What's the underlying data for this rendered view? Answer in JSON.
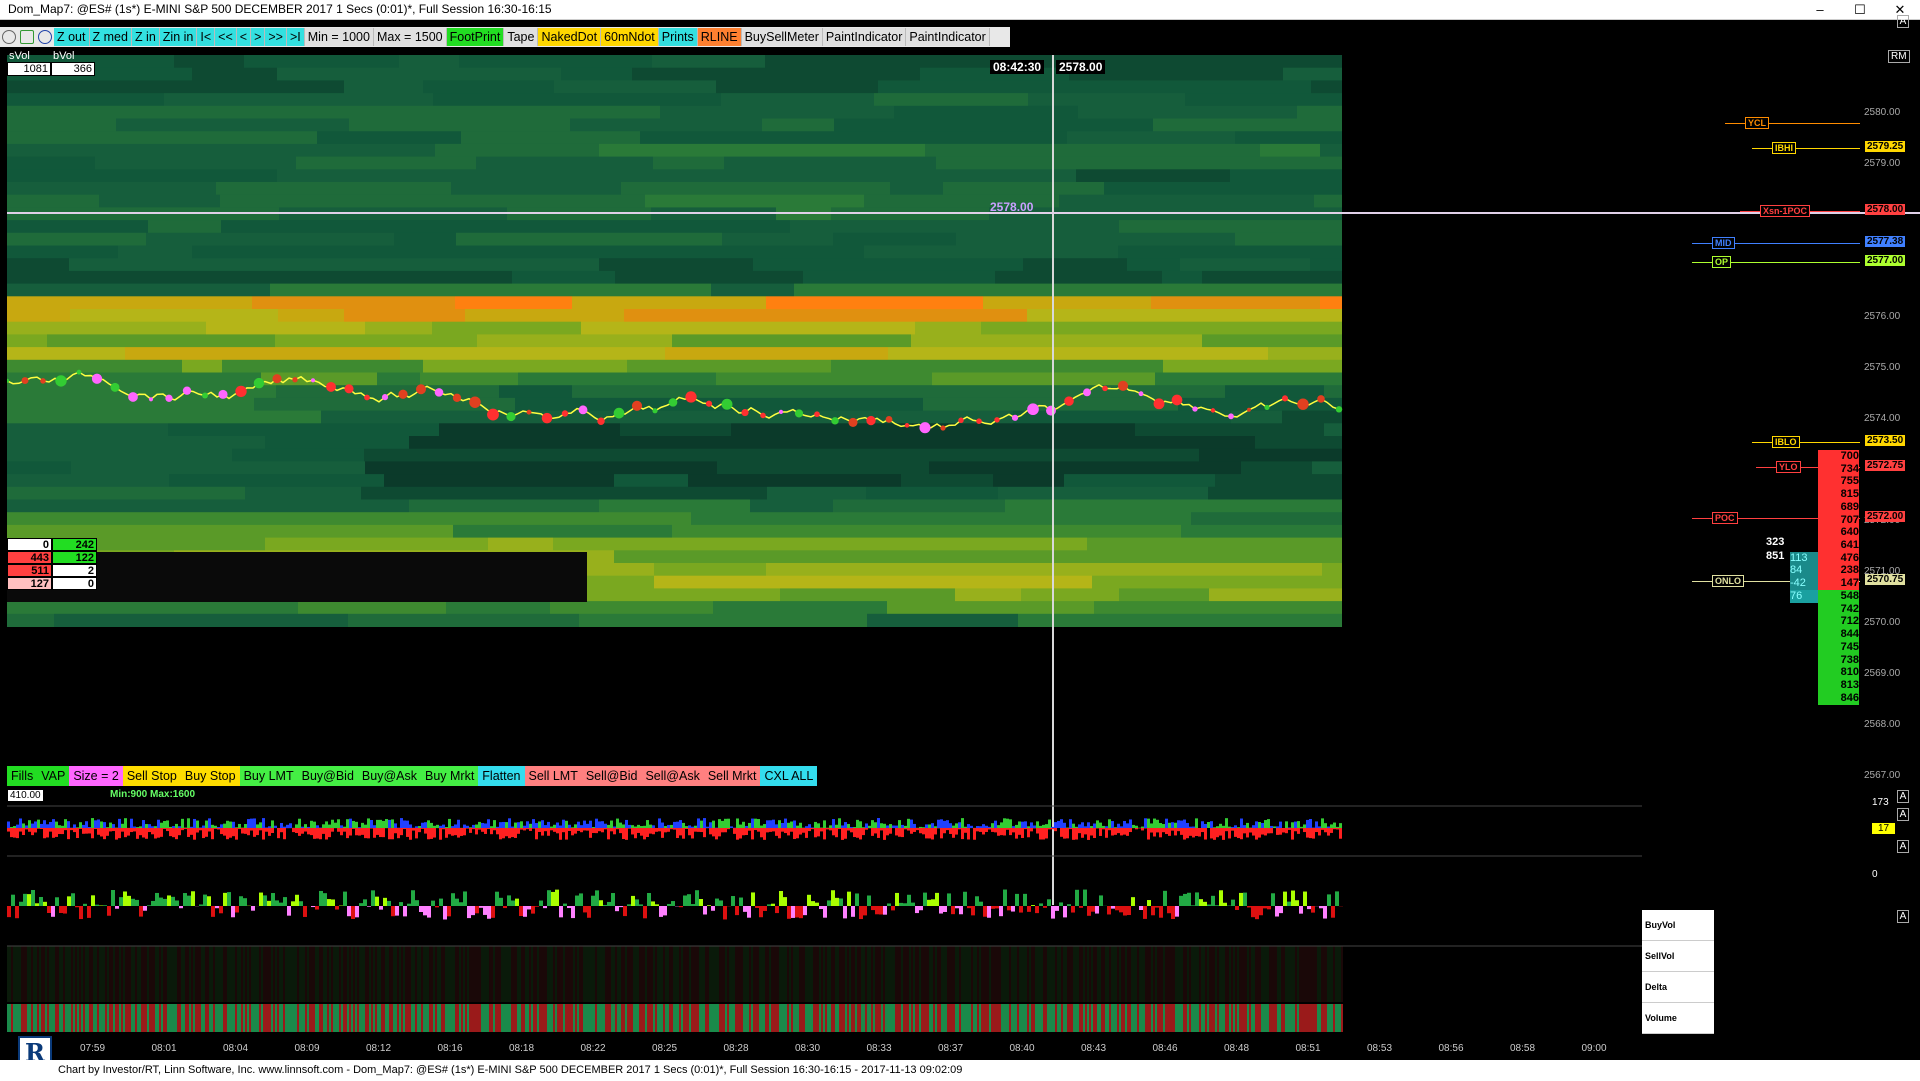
{
  "window": {
    "title": "Dom_Map7: @ES# (1s*) E-MINI S&P 500 DECEMBER 2017 1 Secs (0:01)*, Full Session 16:30-16:15",
    "minimize": "–",
    "maximize": "☐",
    "close": "✕"
  },
  "toolbar": {
    "items": [
      {
        "label": "Z out",
        "style": "cyan"
      },
      {
        "label": "Z med",
        "style": "cyan"
      },
      {
        "label": "Z in",
        "style": "cyan"
      },
      {
        "label": "Zin in",
        "style": "cyan"
      },
      {
        "label": "I<",
        "style": "cyan"
      },
      {
        "label": "<<",
        "style": "cyan"
      },
      {
        "label": "<",
        "style": "cyan"
      },
      {
        "label": ">",
        "style": "cyan"
      },
      {
        "label": ">>",
        "style": "cyan"
      },
      {
        "label": ">I",
        "style": "cyan"
      },
      {
        "label": "Min = 1000",
        "style": "gray"
      },
      {
        "label": "Max = 1500",
        "style": "gray"
      },
      {
        "label": "FootPrint",
        "style": "green"
      },
      {
        "label": "Tape",
        "style": "gray"
      },
      {
        "label": "NakedDot",
        "style": "gold"
      },
      {
        "label": "60mNdot",
        "style": "gold"
      },
      {
        "label": "Prints",
        "style": "cyan"
      },
      {
        "label": "RLINE",
        "style": "orange"
      },
      {
        "label": "BuySellMeter",
        "style": "gray"
      },
      {
        "label": "PaintIndicator",
        "style": "gray"
      },
      {
        "label": "PaintIndicator",
        "style": "gray"
      }
    ]
  },
  "volume_header": {
    "svol_label": "sVol",
    "bvol_label": "bVol",
    "svol": "1081",
    "bvol": "366"
  },
  "crosshair": {
    "time": "08:42:30",
    "price": "2578.00",
    "price_marker": "2578.00"
  },
  "mini_table": [
    {
      "left": "0",
      "right": "242",
      "lstyle": "w",
      "rstyle": "g"
    },
    {
      "left": "443",
      "right": "122",
      "lstyle": "r",
      "rstyle": "g"
    },
    {
      "left": "511",
      "right": "2",
      "lstyle": "r",
      "rstyle": "w"
    },
    {
      "left": "127",
      "right": "0",
      "lstyle": "p",
      "rstyle": "w"
    }
  ],
  "rm_label": "RM",
  "price_axis": {
    "ticks": [
      "2580.00",
      "2579.00",
      "2576.00",
      "2575.00",
      "2574.00",
      "2572.00",
      "2571.00",
      "2570.00",
      "2569.00",
      "2568.00",
      "2567.00"
    ]
  },
  "levels": [
    {
      "label": "YCL",
      "price": "",
      "color": "#ff8c00"
    },
    {
      "label": "IBHI",
      "price": "2579.25",
      "color": "#ffd700"
    },
    {
      "label": "Xsn-1POC",
      "price": "2578.00",
      "color": "#ff4040"
    },
    {
      "label": "MID",
      "price": "2577.38",
      "color": "#4080ff"
    },
    {
      "label": "OP",
      "price": "2577.00",
      "color": "#adff2f"
    },
    {
      "label": "IBLO",
      "price": "2573.50",
      "color": "#ffd700"
    },
    {
      "label": "YLO",
      "price": "2572.75",
      "color": "#ff4040"
    },
    {
      "label": "POC",
      "price": "2572.00",
      "color": "#ff4040"
    },
    {
      "label": "ONLO",
      "price": "2570.75",
      "color": "#e0e0a0"
    }
  ],
  "dom": {
    "left_vals": [
      "323",
      "851"
    ],
    "ask": [
      {
        "l": "",
        "r": "700"
      },
      {
        "l": "",
        "r": "734"
      },
      {
        "l": "",
        "r": "755"
      },
      {
        "l": "",
        "r": "815"
      },
      {
        "l": "",
        "r": "689"
      },
      {
        "l": "",
        "r": "707"
      },
      {
        "l": "",
        "r": "640"
      },
      {
        "l": "",
        "r": "641"
      },
      {
        "l": "113",
        "r": "476"
      },
      {
        "l": "84",
        "r": "238"
      },
      {
        "l": "-42",
        "r": "147"
      }
    ],
    "bid": [
      {
        "l": "76",
        "r": "548"
      },
      {
        "l": "",
        "r": "742"
      },
      {
        "l": "",
        "r": "712"
      },
      {
        "l": "",
        "r": "844"
      },
      {
        "l": "",
        "r": "745"
      },
      {
        "l": "",
        "r": "738"
      },
      {
        "l": "",
        "r": "810"
      },
      {
        "l": "",
        "r": "813"
      },
      {
        "l": "",
        "r": "846"
      }
    ],
    "highlight_price": "2571.00"
  },
  "order_bar": [
    {
      "label": "Fills",
      "style": "ob-green"
    },
    {
      "label": "VAP",
      "style": "ob-green"
    },
    {
      "label": "Size = 2",
      "style": "ob-magenta"
    },
    {
      "label": "Sell Stop",
      "style": "ob-yellow"
    },
    {
      "label": "Buy Stop",
      "style": "ob-yellow"
    },
    {
      "label": "Buy LMT",
      "style": "ob-lgreen"
    },
    {
      "label": "Buy@Bid",
      "style": "ob-lgreen"
    },
    {
      "label": "Buy@Ask",
      "style": "ob-lgreen"
    },
    {
      "label": "Buy Mrkt",
      "style": "ob-lgreen"
    },
    {
      "label": "Flatten",
      "style": "ob-cyan"
    },
    {
      "label": "Sell LMT",
      "style": "ob-pink"
    },
    {
      "label": "Sell@Bid",
      "style": "ob-pink"
    },
    {
      "label": "Sell@Ask",
      "style": "ob-pink"
    },
    {
      "label": "Sell Mrkt",
      "style": "ob-pink"
    },
    {
      "label": "CXL ALL",
      "style": "ob-cyan"
    }
  ],
  "sub_panels": {
    "p1_value": "410.00",
    "p1_range": "Min:900 Max:1600",
    "p1_right": "173",
    "p2_right": "17",
    "p3_right": "0",
    "axis_btn": "A"
  },
  "bottom_labels": [
    "BuyVol",
    "SellVol",
    "Delta",
    "Volume"
  ],
  "time_axis": [
    "07:59",
    "08:01",
    "08:04",
    "08:09",
    "08:12",
    "08:16",
    "08:18",
    "08:22",
    "08:25",
    "08:28",
    "08:30",
    "08:33",
    "08:37",
    "08:40",
    "08:43",
    "08:46",
    "08:48",
    "08:51",
    "08:53",
    "08:56",
    "08:58",
    "09:00"
  ],
  "status": "Chart by Investor/RT, Linn Software, Inc. www.linnsoft.com - Dom_Map7: @ES# (1s*) E-MINI S&P 500 DECEMBER 2017 1 Secs (0:01)*, Full Session 16:30-16:15 - 2017-11-13 09:02:09",
  "logo_letter": "R"
}
